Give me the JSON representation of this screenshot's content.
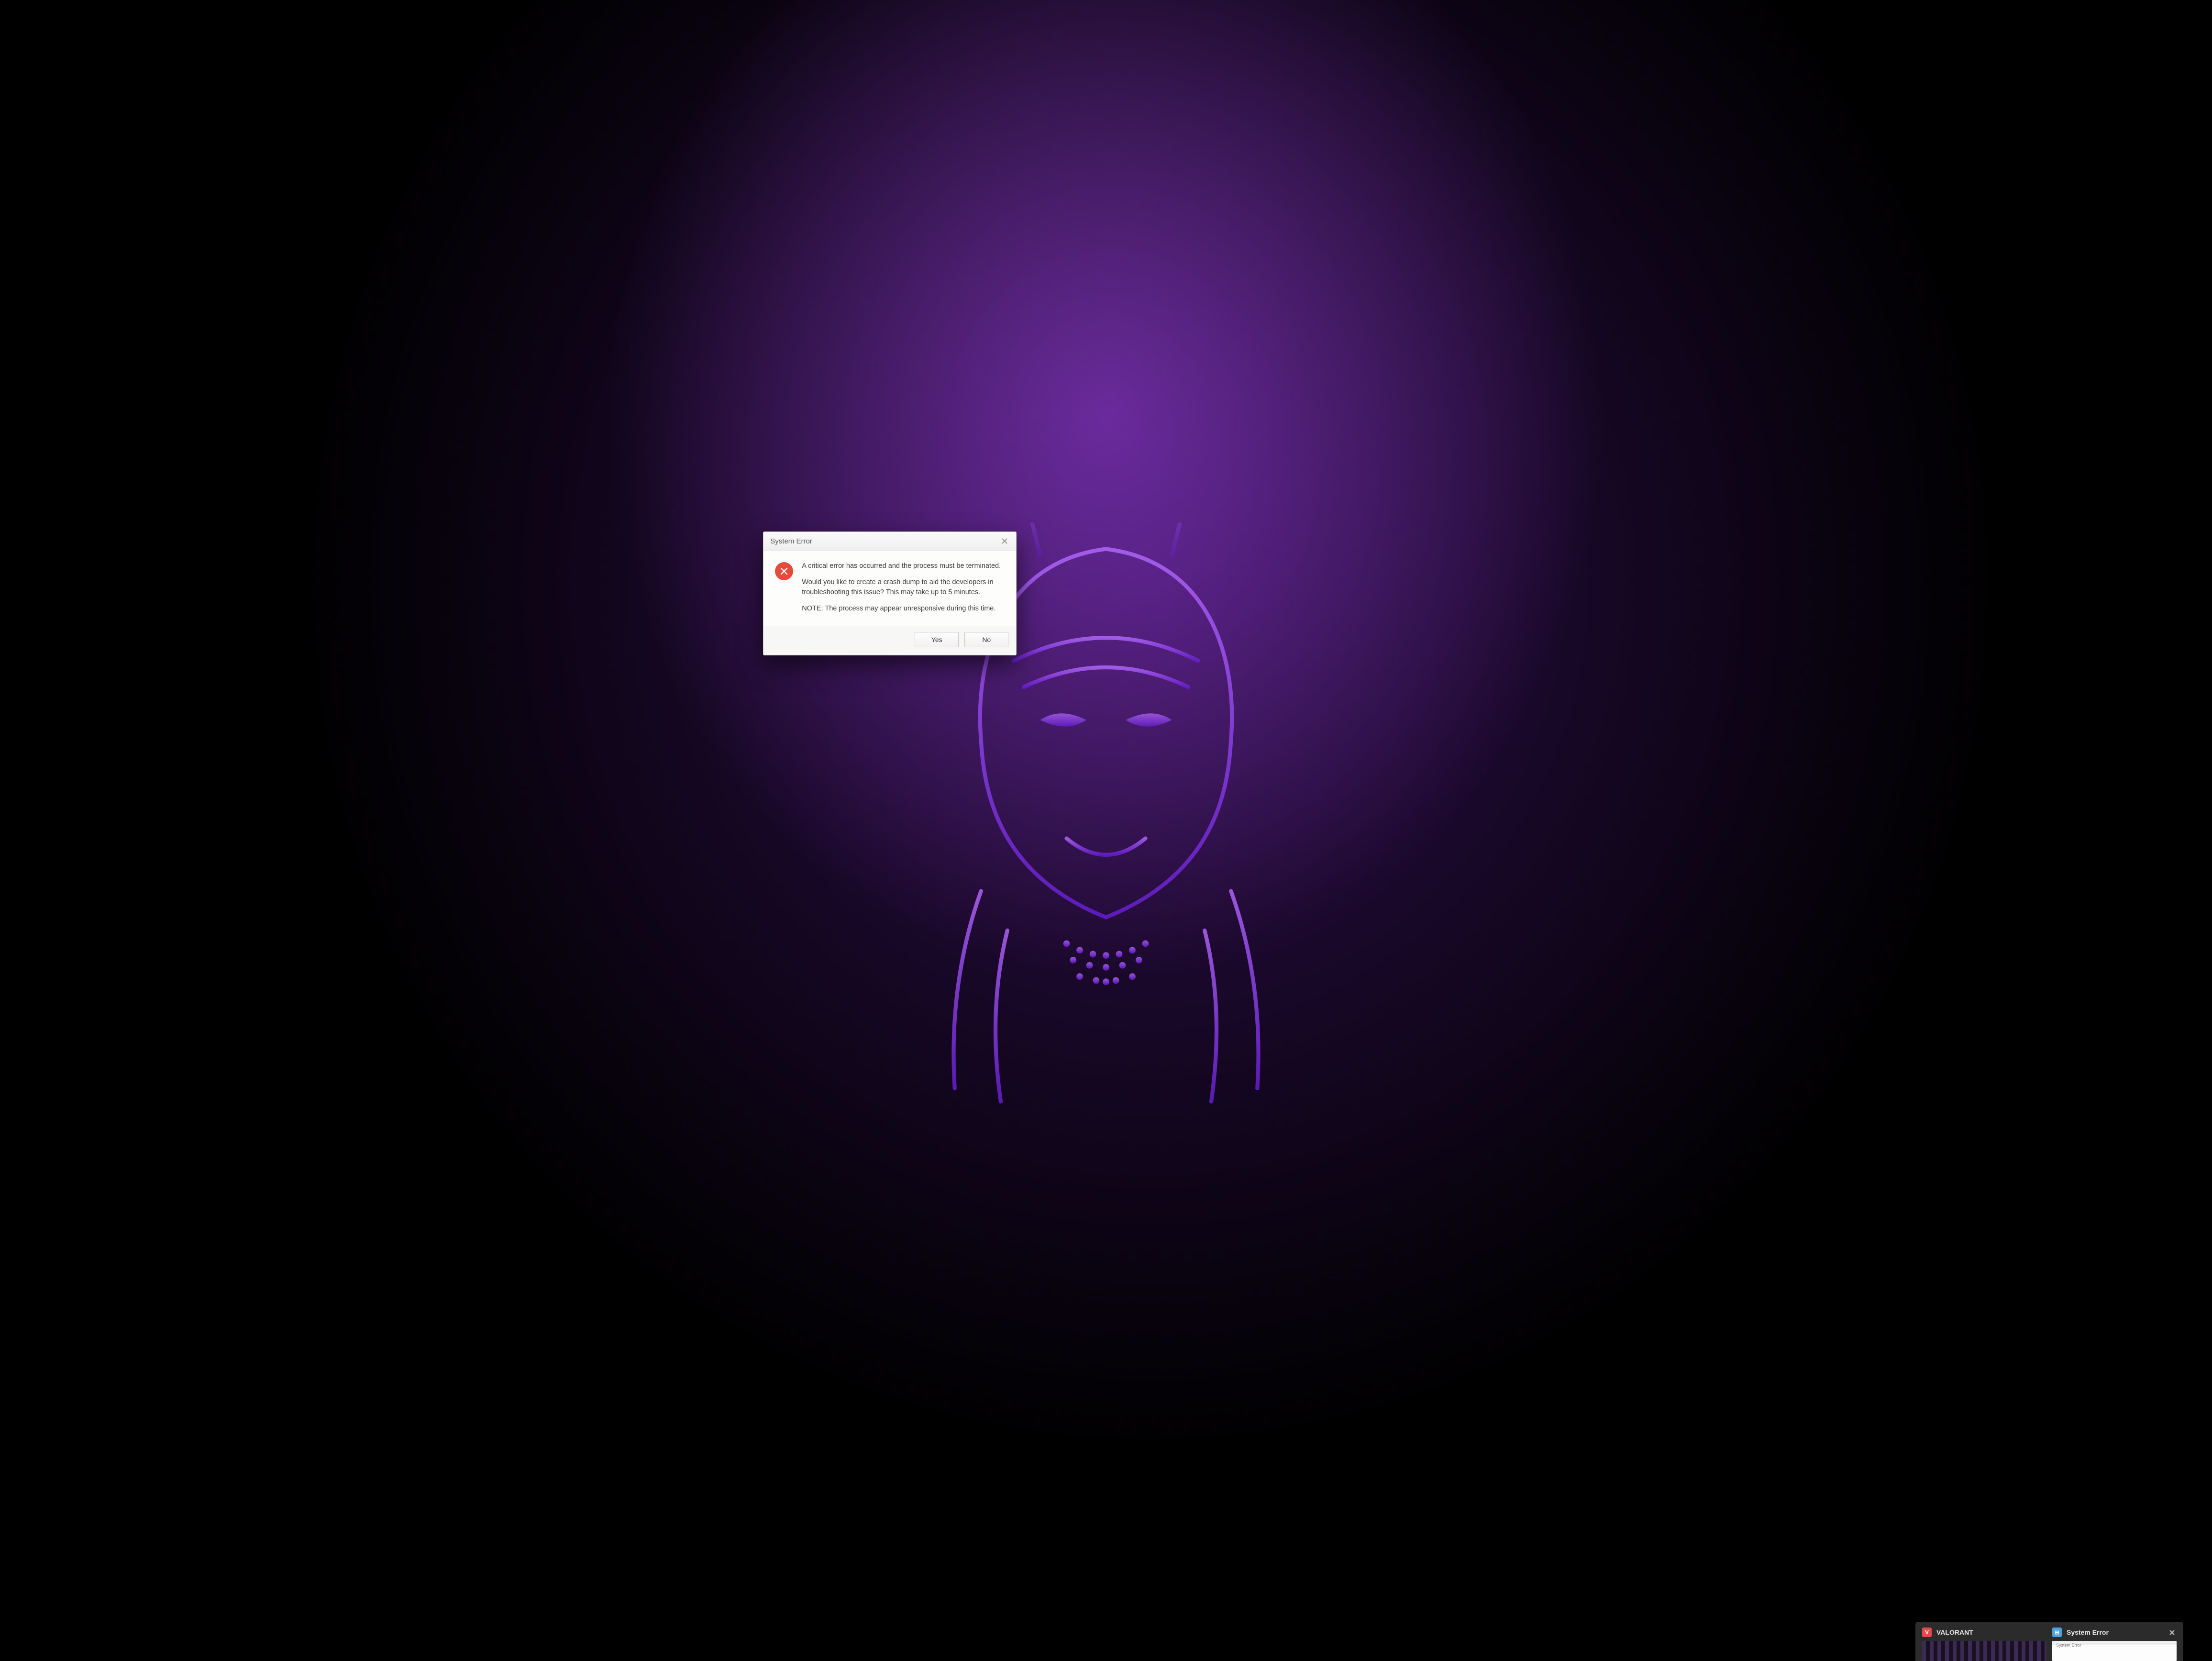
{
  "dialog": {
    "title": "System Error",
    "paragraphs": [
      "A critical error has occurred and the process must be terminated.",
      "Would you like to create a crash dump to aid the developers in troubleshooting this issue? This may take up to 5 minutes.",
      "NOTE: The process may appear unresponsive during this time."
    ],
    "buttons": {
      "yes": "Yes",
      "no": "No"
    }
  },
  "task_preview": {
    "items": [
      {
        "title": "VALORANT",
        "icon_glyph": "V",
        "icon_type": "valorant"
      },
      {
        "title": "System Error",
        "icon_glyph": "⊞",
        "icon_type": "sys",
        "mini_title": "System Error"
      }
    ]
  }
}
